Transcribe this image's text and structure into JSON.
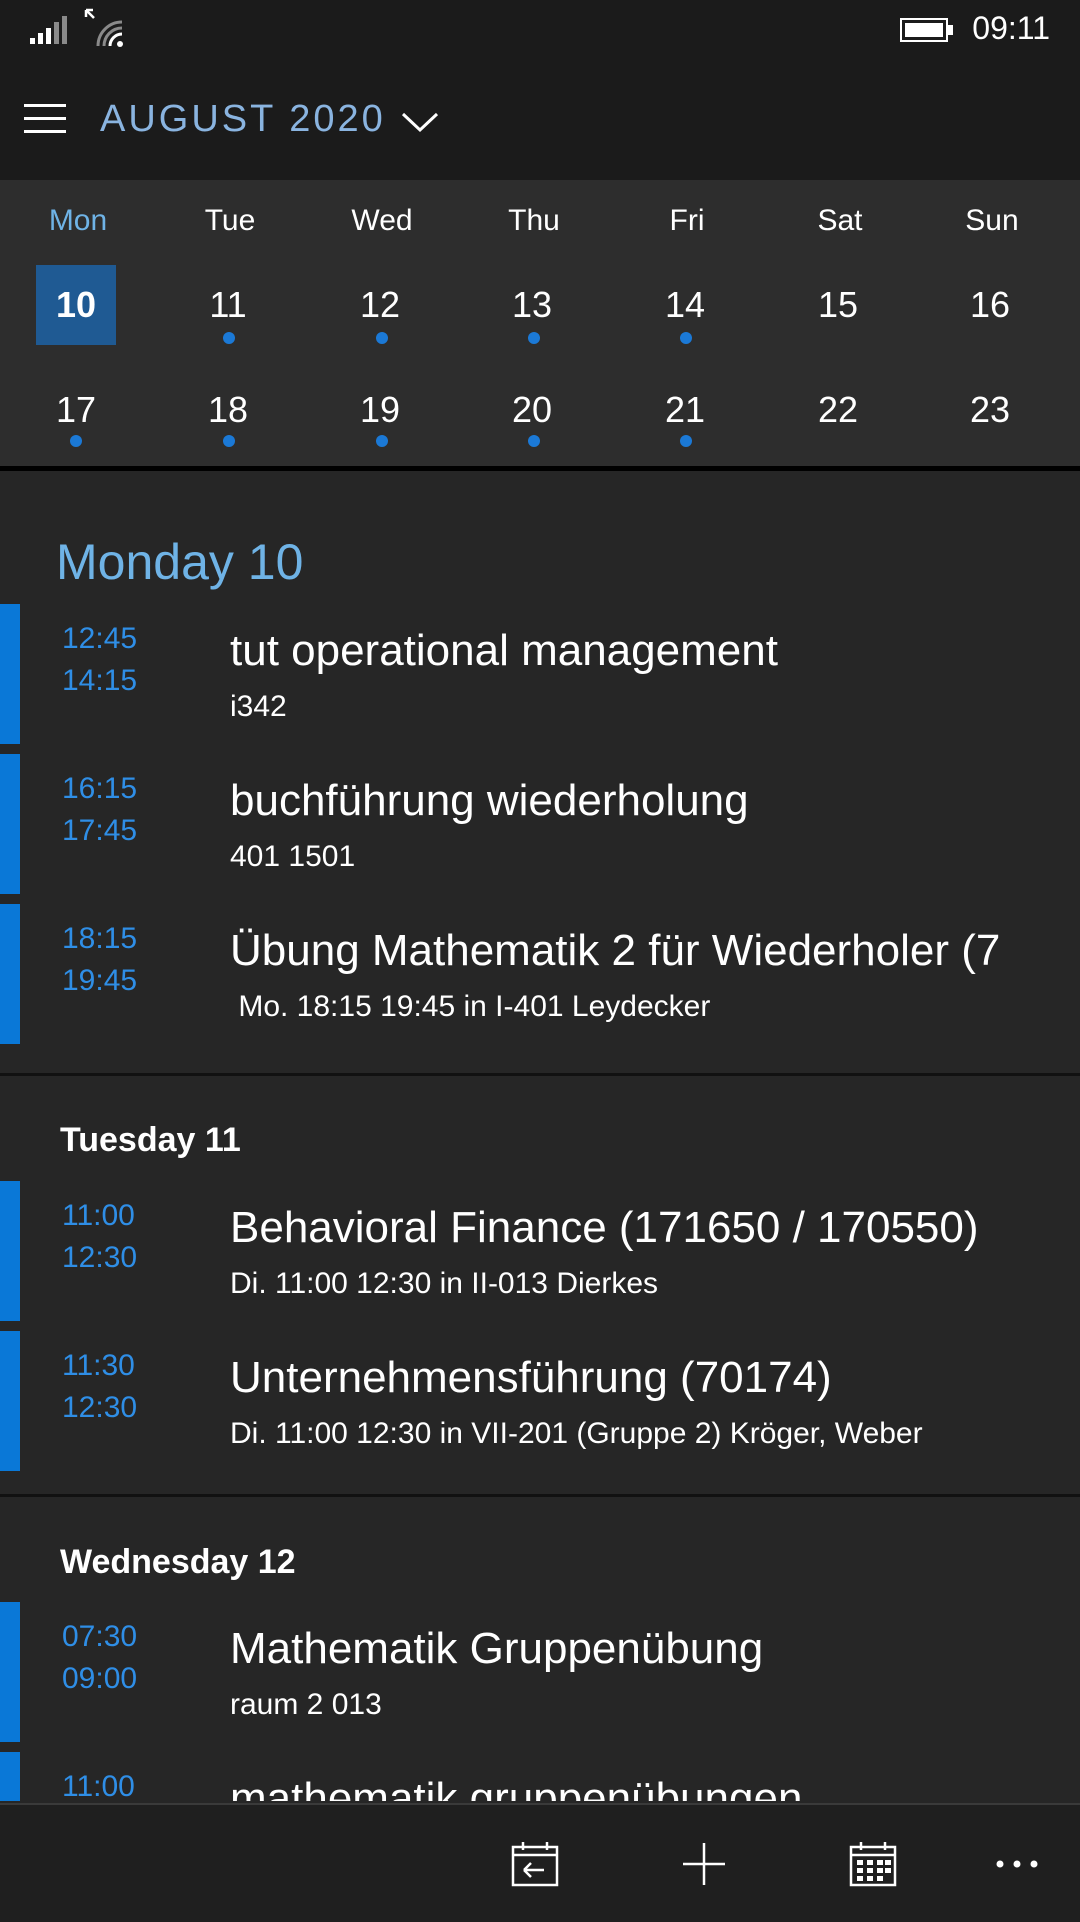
{
  "status_bar": {
    "time": "09:11",
    "icons": [
      "signal-icon",
      "wifi-icon",
      "battery-icon"
    ]
  },
  "header": {
    "month": "AUGUST 2020",
    "menu_icon": "hamburger-icon",
    "expand_icon": "chevron-down-icon"
  },
  "calendar": {
    "weekdays": [
      "Mon",
      "Tue",
      "Wed",
      "Thu",
      "Fri",
      "Sat",
      "Sun"
    ],
    "active_weekday_index": 0,
    "weeks": [
      {
        "days": [
          "10",
          "11",
          "12",
          "13",
          "14",
          "15",
          "16"
        ],
        "dots": [
          false,
          true,
          true,
          true,
          true,
          false,
          false
        ]
      },
      {
        "days": [
          "17",
          "18",
          "19",
          "20",
          "21",
          "22",
          "23"
        ],
        "dots": [
          true,
          true,
          true,
          true,
          true,
          false,
          false
        ]
      }
    ],
    "today": "10",
    "accent_color": "#1f5a93",
    "dot_color": "#1b79d6"
  },
  "agenda": {
    "days": [
      {
        "heading": "Monday 10",
        "events": [
          {
            "start": "12:45",
            "end": "14:15",
            "title": "tut operational management",
            "subtitle": "i342"
          },
          {
            "start": "16:15",
            "end": "17:45",
            "title": "buchführung wiederholung",
            "subtitle": "401 1501"
          },
          {
            "start": "18:15",
            "end": "19:45",
            "title": "Übung Mathematik 2 für Wiederholer (7",
            "subtitle": " Mo. 18:15 19:45 in I-401 Leydecker"
          }
        ]
      },
      {
        "heading": "Tuesday 11",
        "events": [
          {
            "start": "11:00",
            "end": "12:30",
            "title": "Behavioral Finance (171650 / 170550)",
            "subtitle": "Di. 11:00 12:30 in II-013 Dierkes"
          },
          {
            "start": "11:30",
            "end": "12:30",
            "title": "Unternehmensführung (70174)",
            "subtitle": "Di. 11:00 12:30 in VII-201 (Gruppe 2) Kröger, Weber"
          }
        ]
      },
      {
        "heading": "Wednesday 12",
        "events": [
          {
            "start": "07:30",
            "end": "09:00",
            "title": "Mathematik Gruppenübung",
            "subtitle": "raum 2 013"
          },
          {
            "start": "11:00",
            "end": "",
            "title": "mathematik gruppenübungen",
            "subtitle": ""
          }
        ]
      }
    ],
    "event_color": "#0a78d7",
    "time_color": "#2f8ee6"
  },
  "app_bar": {
    "buttons": [
      "today-icon",
      "add-icon",
      "month-view-icon",
      "more-icon"
    ]
  }
}
